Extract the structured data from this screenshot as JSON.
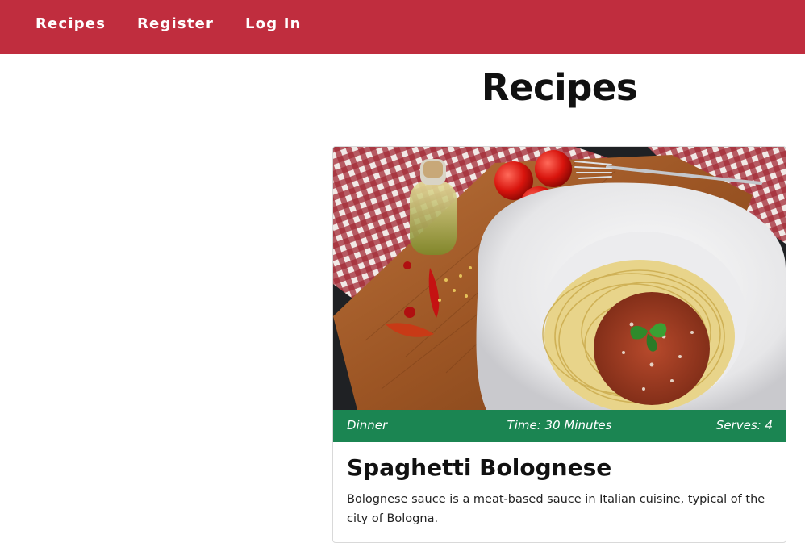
{
  "navbar": {
    "background": "#c02d3e",
    "links": [
      "Recipes",
      "Register",
      "Log In"
    ]
  },
  "page": {
    "title": "Recipes"
  },
  "recipe_card": {
    "image_icon": "spaghetti-bolognese-photo",
    "category": "Dinner",
    "time": "Time: 30 Minutes",
    "serves": "Serves: 4",
    "meta_bar_color": "#1b8552",
    "title": "Spaghetti Bolognese",
    "description": "Bolognese sauce is a meat-based sauce in Italian cuisine, typical of the city of Bologna."
  }
}
